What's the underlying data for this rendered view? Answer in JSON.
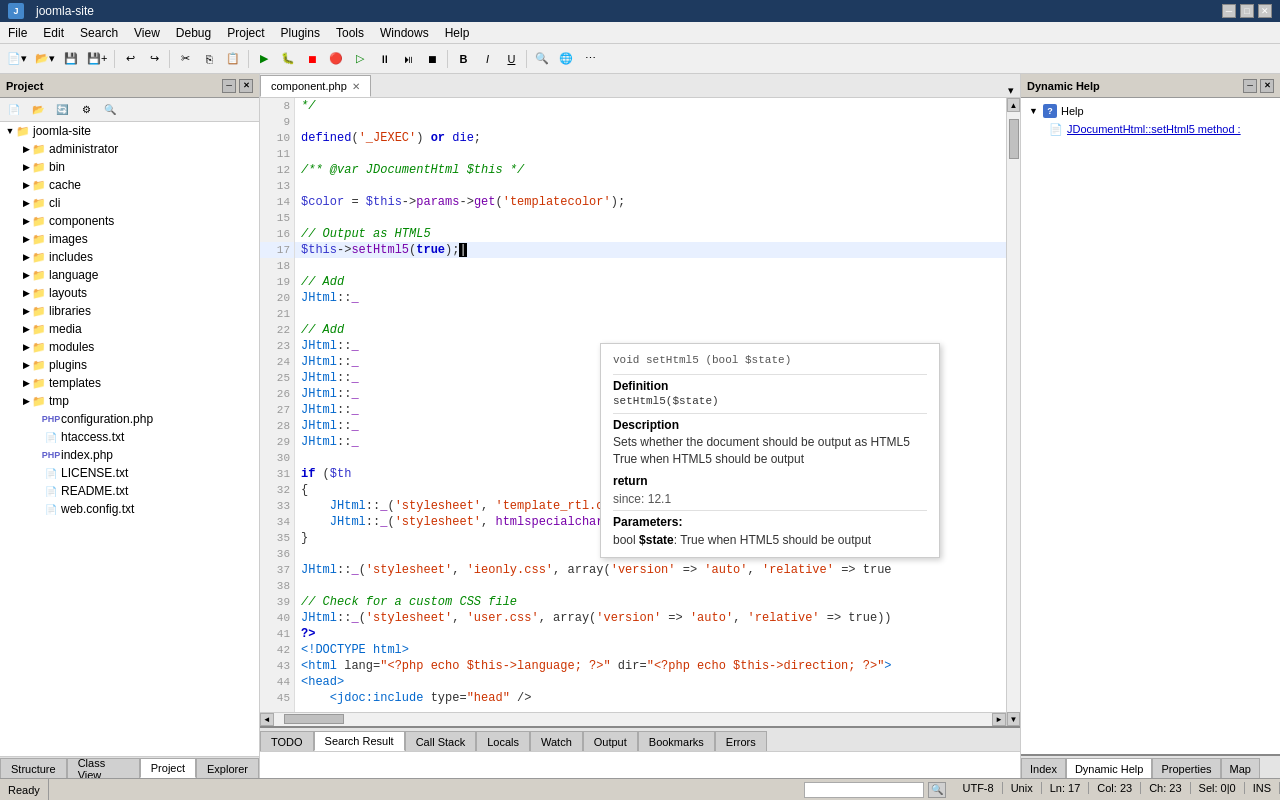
{
  "window": {
    "title": "joomla-site"
  },
  "titlebar": {
    "minimize": "─",
    "maximize": "□",
    "close": "✕"
  },
  "menubar": {
    "items": [
      "File",
      "Edit",
      "Search",
      "View",
      "Debug",
      "Project",
      "Plugins",
      "Tools",
      "Windows",
      "Help"
    ]
  },
  "project_panel": {
    "title": "Project",
    "close_btn": "✕",
    "minimize_btn": "─"
  },
  "project_tree": {
    "root": "joomla-site",
    "items": [
      {
        "label": "administrator",
        "type": "folder",
        "depth": 1,
        "expanded": false
      },
      {
        "label": "bin",
        "type": "folder",
        "depth": 1,
        "expanded": false
      },
      {
        "label": "cache",
        "type": "folder",
        "depth": 1,
        "expanded": false
      },
      {
        "label": "cli",
        "type": "folder",
        "depth": 1,
        "expanded": false
      },
      {
        "label": "components",
        "type": "folder",
        "depth": 1,
        "expanded": false
      },
      {
        "label": "images",
        "type": "folder",
        "depth": 1,
        "expanded": false
      },
      {
        "label": "includes",
        "type": "folder",
        "depth": 1,
        "expanded": false
      },
      {
        "label": "language",
        "type": "folder",
        "depth": 1,
        "expanded": false
      },
      {
        "label": "layouts",
        "type": "folder",
        "depth": 1,
        "expanded": false
      },
      {
        "label": "libraries",
        "type": "folder",
        "depth": 1,
        "expanded": false
      },
      {
        "label": "media",
        "type": "folder",
        "depth": 1,
        "expanded": false
      },
      {
        "label": "modules",
        "type": "folder",
        "depth": 1,
        "expanded": false
      },
      {
        "label": "plugins",
        "type": "folder",
        "depth": 1,
        "expanded": false
      },
      {
        "label": "templates",
        "type": "folder",
        "depth": 1,
        "expanded": false
      },
      {
        "label": "tmp",
        "type": "folder",
        "depth": 1,
        "expanded": false
      },
      {
        "label": "configuration.php",
        "type": "php",
        "depth": 1
      },
      {
        "label": "htaccess.txt",
        "type": "txt",
        "depth": 1
      },
      {
        "label": "index.php",
        "type": "php",
        "depth": 1
      },
      {
        "label": "LICENSE.txt",
        "type": "txt",
        "depth": 1
      },
      {
        "label": "README.txt",
        "type": "txt",
        "depth": 1
      },
      {
        "label": "web.config.txt",
        "type": "txt",
        "depth": 1
      }
    ]
  },
  "editor": {
    "tab": "component.php",
    "lines": [
      {
        "n": 8,
        "code": "*/"
      },
      {
        "n": 9,
        "code": ""
      },
      {
        "n": 10,
        "code": "defined('_JEXEC') or die;"
      },
      {
        "n": 11,
        "code": ""
      },
      {
        "n": 12,
        "code": "/** @var JDocumentHtml $this */"
      },
      {
        "n": 13,
        "code": ""
      },
      {
        "n": 14,
        "code": "$color = $this->params->get('templatecolor');"
      },
      {
        "n": 15,
        "code": ""
      },
      {
        "n": 16,
        "code": "// Output as HTML5"
      },
      {
        "n": 17,
        "code": "$this->setHtml5(true);",
        "active": true
      },
      {
        "n": 18,
        "code": ""
      },
      {
        "n": 19,
        "code": "// Add"
      },
      {
        "n": 20,
        "code": "JHtml::_"
      },
      {
        "n": 21,
        "code": ""
      },
      {
        "n": 22,
        "code": "// Add"
      },
      {
        "n": 23,
        "code": "JHtml::_"
      },
      {
        "n": 24,
        "code": "JHtml::_"
      },
      {
        "n": 25,
        "code": "JHtml::_"
      },
      {
        "n": 26,
        "code": "JHtml::_"
      },
      {
        "n": 27,
        "code": "JHtml::_"
      },
      {
        "n": 28,
        "code": "JHtml::_"
      },
      {
        "n": 29,
        "code": "JHtml::_"
      },
      {
        "n": 30,
        "code": ""
      },
      {
        "n": 31,
        "code": "if ($th"
      },
      {
        "n": 32,
        "code": "{"
      },
      {
        "n": 33,
        "code": "    JHtml::_('stylesheet', 'template_rtl.css', array('version' => 'auto', 'relativ"
      },
      {
        "n": 34,
        "code": "    JHtml::_('stylesheet', htmlspecialchars($color, ENT_COMPAT, 'UTF-8') . '_rtl.c"
      },
      {
        "n": 35,
        "code": "}"
      },
      {
        "n": 36,
        "code": ""
      },
      {
        "n": 37,
        "code": "JHtml::_('stylesheet', 'ieonly.css', array('version' => 'auto', 'relative' => true"
      },
      {
        "n": 38,
        "code": ""
      },
      {
        "n": 39,
        "code": "// Check for a custom CSS file"
      },
      {
        "n": 40,
        "code": "JHtml::_('stylesheet', 'user.css', array('version' => 'auto', 'relative' => true))"
      },
      {
        "n": 41,
        "code": "?>"
      },
      {
        "n": 42,
        "code": "<!DOCTYPE html>"
      },
      {
        "n": 43,
        "code": "<html lang=\"<?php echo $this->language; ?>\" dir=\"<?php echo $this->direction; ?>\">"
      },
      {
        "n": 44,
        "code": "<head>"
      },
      {
        "n": 45,
        "code": "    <jdoc:include type=\"head\" />"
      }
    ]
  },
  "tooltip": {
    "signature": "void setHtml5 (bool $state)",
    "definition_title": "Definition",
    "definition_code": "setHtml5($state)",
    "description_title": "Description",
    "description": "Sets whether the document should be output as HTML5\nTrue when HTML5 should be output",
    "return_label": "return",
    "since_label": "since:",
    "since_value": "12.1",
    "params_title": "Parameters:",
    "param_type": "bool",
    "param_name": "$state",
    "param_desc": ": True when HTML5 should be output"
  },
  "dynamic_help": {
    "title": "Dynamic Help",
    "items": [
      {
        "label": "Help",
        "type": "root"
      },
      {
        "label": "JDocumentHtml::setHtml5 method :",
        "type": "doc"
      }
    ]
  },
  "bottom_tabs": {
    "items": [
      "TODO",
      "Search Result",
      "Call Stack",
      "Locals",
      "Watch",
      "Output",
      "Bookmarks",
      "Errors"
    ]
  },
  "bottom_panel_tabs": {
    "right": [
      "Index",
      "Dynamic Help",
      "Properties",
      "Map"
    ]
  },
  "statusbar": {
    "ready": "Ready",
    "encoding": "UTF-8",
    "line_ending": "Unix",
    "position": "Ln: 17",
    "col": "Col: 23",
    "ch": "Ch: 23",
    "sel": "Sel: 0|0",
    "ins": "INS"
  }
}
